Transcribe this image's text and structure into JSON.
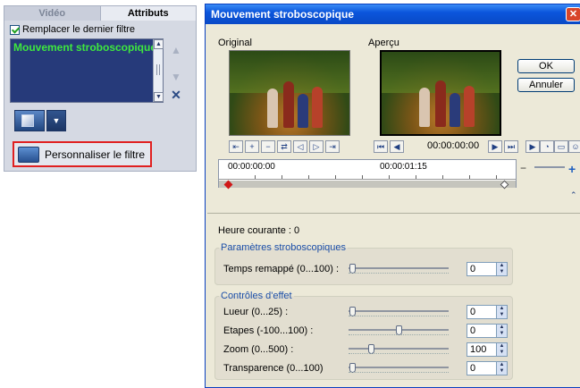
{
  "left_panel": {
    "tabs": [
      "Vidéo",
      "Attributs"
    ],
    "replace_last_filter": "Remplacer le dernier filtre",
    "filters": [
      "Mouvement stroboscopique"
    ],
    "customize_button": "Personnaliser le filtre"
  },
  "dialog": {
    "title": "Mouvement stroboscopique",
    "original_label": "Original",
    "preview_label": "Aperçu",
    "ok": "OK",
    "cancel": "Annuler",
    "timecode": "00:00:00:00",
    "timeline": {
      "start": "00:00:00:00",
      "mid": "00:00:01:15"
    },
    "current_time": "Heure courante : 0",
    "strobe_group": {
      "title": "Paramètres stroboscopiques",
      "params": [
        {
          "label": "Temps remappé (0...100) :",
          "value": "0",
          "position": 0
        }
      ]
    },
    "effects_group": {
      "title": "Contrôles d'effet",
      "params": [
        {
          "label": "Lueur (0...25) :",
          "value": "0",
          "position": 0
        },
        {
          "label": "Etapes (-100...100) :",
          "value": "0",
          "position": 0.5
        },
        {
          "label": "Zoom (0...500) :",
          "value": "100",
          "position": 0.2
        },
        {
          "label": "Transparence (0...100)",
          "value": "0",
          "position": 0
        }
      ]
    }
  },
  "colors": {
    "titlebar": "#0b55dc",
    "filter_list_bg": "#263a7a",
    "filter_text": "#3ee83e",
    "highlight_border": "#e02020"
  }
}
